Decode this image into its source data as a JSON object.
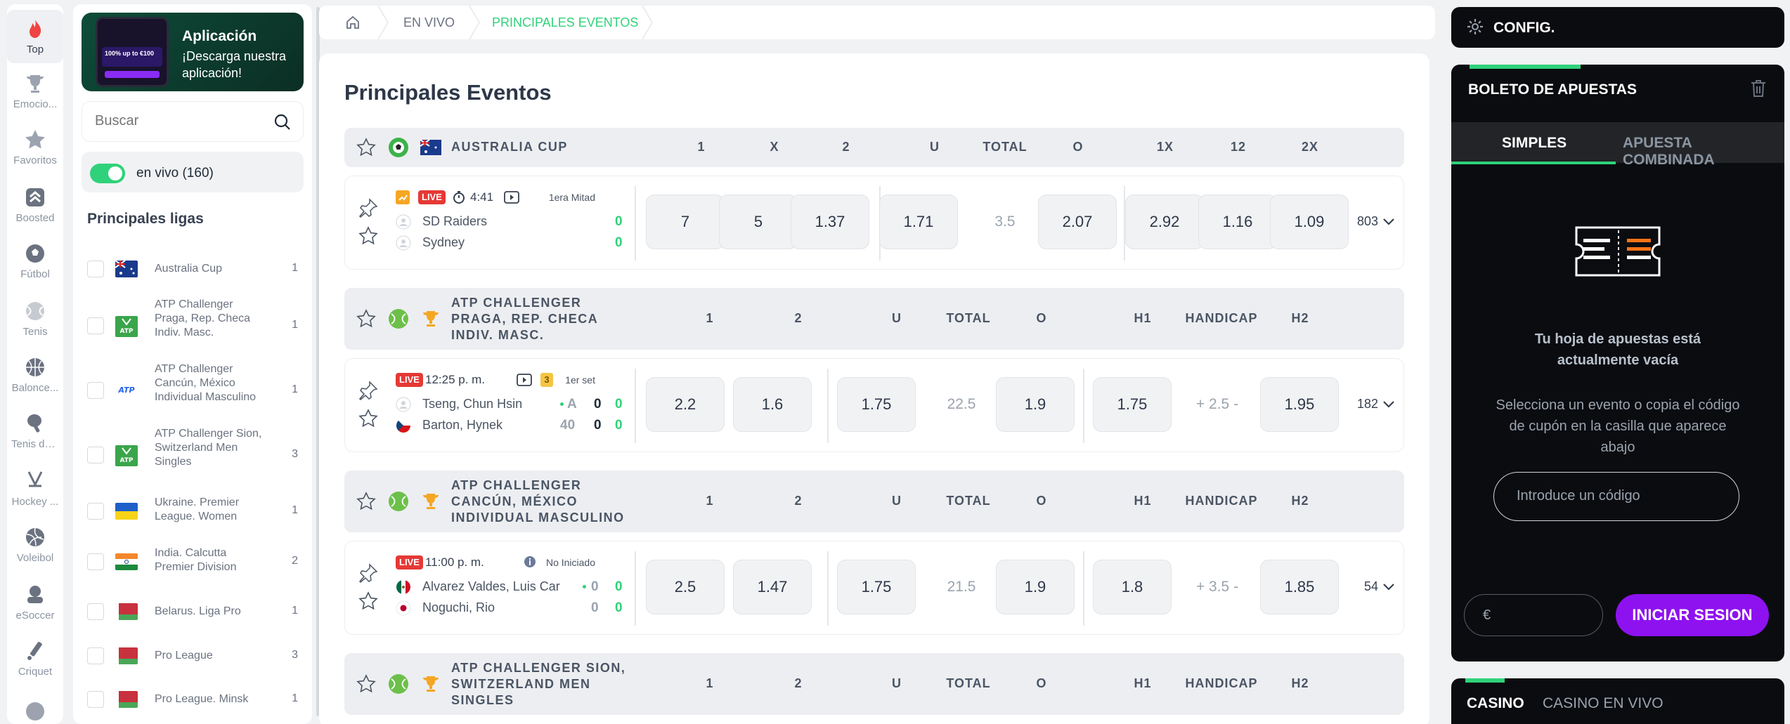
{
  "rail": [
    {
      "label": "Top",
      "icon": "flame-icon",
      "active": true
    },
    {
      "label": "Emocio...",
      "icon": "trophy-icon"
    },
    {
      "label": "Favoritos",
      "icon": "star-icon"
    },
    {
      "label": "Boosted",
      "icon": "boost-icon"
    },
    {
      "label": "Fútbol",
      "icon": "soccer-ball-icon"
    },
    {
      "label": "Tenis",
      "icon": "tennis-ball-icon"
    },
    {
      "label": "Balonce...",
      "icon": "basketball-icon"
    },
    {
      "label": "Tenis de...",
      "icon": "table-tennis-icon"
    },
    {
      "label": "Hockey ...",
      "icon": "hockey-icon"
    },
    {
      "label": "Voleibol",
      "icon": "volleyball-icon"
    },
    {
      "label": "eSoccer",
      "icon": "esoccer-icon"
    },
    {
      "label": "Criquet",
      "icon": "cricket-icon"
    }
  ],
  "promo": {
    "title": "Aplicación",
    "subtitle": "¡Descarga nuestra aplicación!",
    "phone_text": "100% up to €100"
  },
  "search": {
    "placeholder": "Buscar"
  },
  "live_toggle": {
    "label": "en vivo (160)",
    "on": true
  },
  "leagues": {
    "title": "Principales ligas",
    "items": [
      {
        "name": "Australia Cup",
        "count": "1",
        "flag": "australia"
      },
      {
        "name": "ATP Challenger Praga, Rep. Checa Indiv. Masc.",
        "count": "1",
        "flag": "atp"
      },
      {
        "name": "ATP Challenger Cancún, México Individual Masculino",
        "count": "1",
        "flag": "atp-plain"
      },
      {
        "name": "ATP Challenger Sion, Switzerland Men Singles",
        "count": "3",
        "flag": "atp"
      },
      {
        "name": "Ukraine. Premier League. Women",
        "count": "1",
        "flag": "ukraine"
      },
      {
        "name": "India. Calcutta Premier Division",
        "count": "2",
        "flag": "india"
      },
      {
        "name": "Belarus. Liga Pro",
        "count": "1",
        "flag": "belarus"
      },
      {
        "name": "Pro League",
        "count": "3",
        "flag": "belarus"
      },
      {
        "name": "Pro League. Minsk",
        "count": "1",
        "flag": "belarus"
      }
    ]
  },
  "breadcrumb": {
    "home_icon": "home-icon",
    "items": [
      "EN VIVO",
      "PRINCIPALES EVENTOS"
    ]
  },
  "main": {
    "title": "Principales Eventos",
    "groups": [
      {
        "title": "AUSTRALIA CUP",
        "sport": "soccer",
        "flag": "australia",
        "columns": [
          "1",
          "X",
          "2",
          "U",
          "TOTAL",
          "O",
          "1X",
          "12",
          "2X"
        ],
        "event": {
          "time": "4:41",
          "stage": "1era Mitad",
          "live_label": "LIVE",
          "team1": "SD Raiders",
          "team2": "Sydney",
          "score1": [
            "0"
          ],
          "score2": [
            "0"
          ],
          "odds": [
            "7",
            "5",
            "1.37",
            "1.71",
            "3.5",
            "2.07",
            "2.92",
            "1.16",
            "1.09"
          ],
          "more": "803"
        }
      },
      {
        "title": "ATP CHALLENGER PRAGA, REP. CHECA INDIV. MASC.",
        "sport": "tennis",
        "columns": [
          "1",
          "2",
          "U",
          "TOTAL",
          "O",
          "H1",
          "HANDICAP",
          "H2"
        ],
        "event": {
          "time": "12:25 p. m.",
          "stage": "1er set",
          "live_label": "LIVE",
          "set_badge": "3",
          "team1": "Tseng, Chun Hsin",
          "team2": "Barton, Hynek",
          "score1": [
            "A",
            "0",
            "0"
          ],
          "score2": [
            "40",
            "0",
            "0"
          ],
          "odds": [
            "2.2",
            "1.6",
            "1.75",
            "22.5",
            "1.9",
            "1.75",
            "+ 2.5 -",
            "1.95"
          ],
          "more": "182"
        }
      },
      {
        "title": "ATP CHALLENGER CANCÚN, MÉXICO INDIVIDUAL MASCULINO",
        "sport": "tennis",
        "columns": [
          "1",
          "2",
          "U",
          "TOTAL",
          "O",
          "H1",
          "HANDICAP",
          "H2"
        ],
        "event": {
          "time": "11:00 p. m.",
          "stage": "No Iniciado",
          "live_label": "LIVE",
          "team1": "Alvarez Valdes, Luis Carlos",
          "team2": "Noguchi, Rio",
          "score1": [
            "0",
            "0"
          ],
          "score2": [
            "0",
            "0"
          ],
          "odds": [
            "2.5",
            "1.47",
            "1.75",
            "21.5",
            "1.9",
            "1.8",
            "+ 3.5 -",
            "1.85"
          ],
          "more": "54"
        }
      },
      {
        "title": "ATP CHALLENGER SION, SWITZERLAND MEN SINGLES",
        "sport": "tennis",
        "columns": [
          "1",
          "2",
          "U",
          "TOTAL",
          "O",
          "H1",
          "HANDICAP",
          "H2"
        ]
      }
    ]
  },
  "config": {
    "label": "CONFIG."
  },
  "betslip": {
    "title": "BOLETO DE APUESTAS",
    "tabs": [
      "SIMPLES",
      "APUESTA COMBINADA"
    ],
    "empty_title": "Tu hoja de apuestas está actualmente vacía",
    "empty_text": "Selecciona un evento o copia el código de cupón en la casilla que aparece abajo",
    "code_placeholder": "Introduce un código",
    "amount_placeholder": "€",
    "login_label": "INICIAR SESION"
  },
  "casino": {
    "tabs": [
      "CASINO",
      "CASINO EN VIVO"
    ]
  },
  "colors": {
    "accent_green": "#2fd27a",
    "live_red": "#e53935",
    "purple": "#8e12f0",
    "dark_panel": "#0b0c10"
  }
}
